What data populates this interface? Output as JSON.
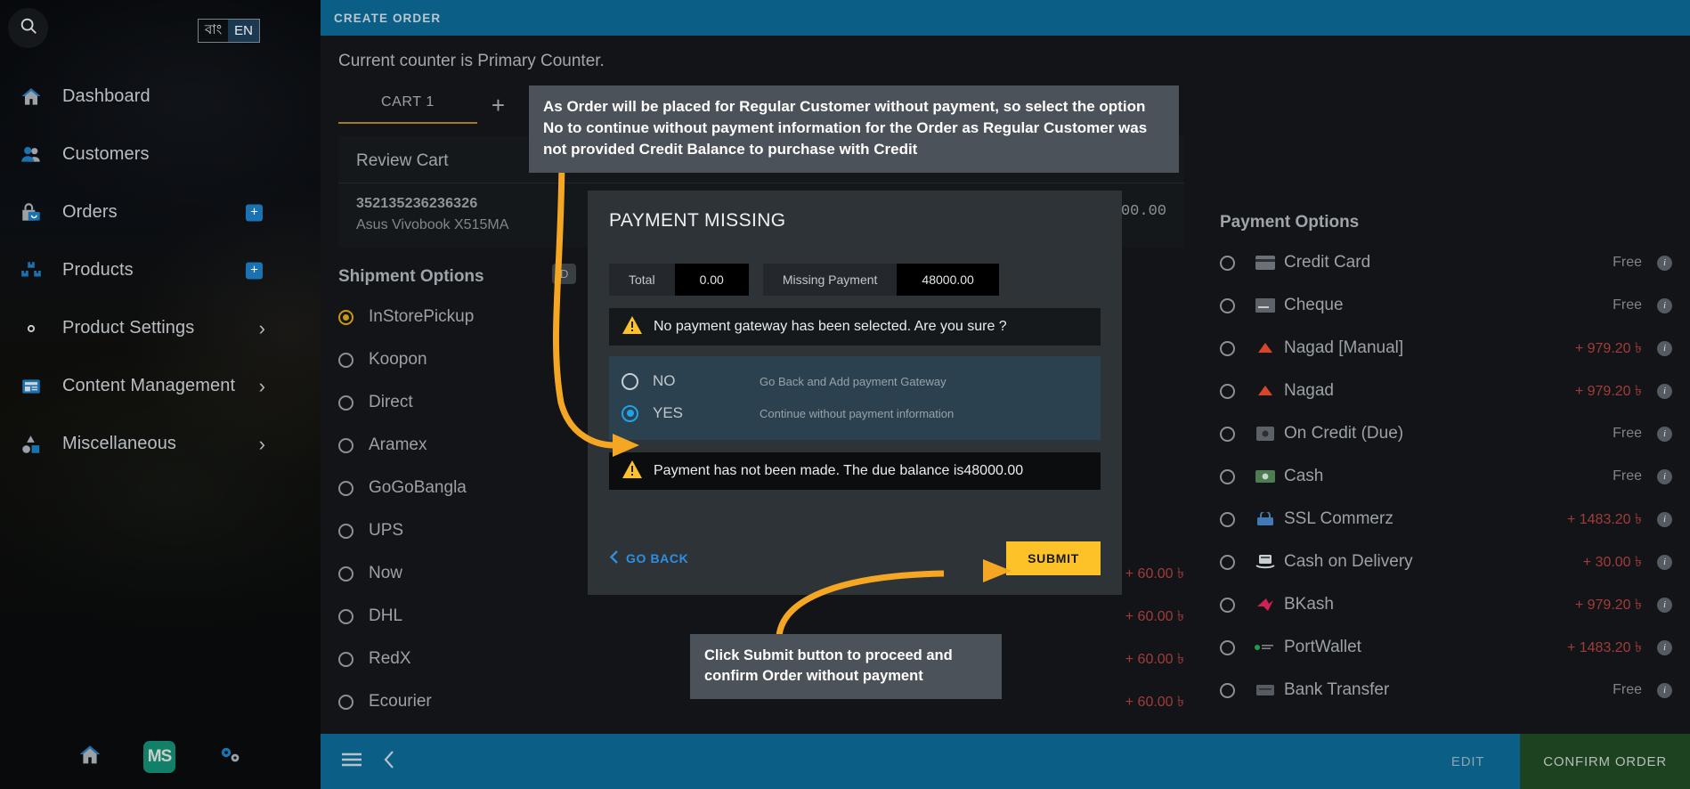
{
  "sidebar": {
    "search_icon": "search-icon",
    "language": {
      "bangla": "বাং",
      "english": "EN",
      "active": "EN"
    },
    "items": [
      {
        "label": "Dashboard",
        "icon": "home-icon",
        "badge": "",
        "chevron": false
      },
      {
        "label": "Customers",
        "icon": "users-icon",
        "badge": "",
        "chevron": false
      },
      {
        "label": "Orders",
        "icon": "bag-icon",
        "badge": "+",
        "chevron": false
      },
      {
        "label": "Products",
        "icon": "boxes-icon",
        "badge": "+",
        "chevron": false
      },
      {
        "label": "Product Settings",
        "icon": "gear-icon",
        "badge": "",
        "chevron": true
      },
      {
        "label": "Content Management",
        "icon": "article-icon",
        "badge": "",
        "chevron": true
      },
      {
        "label": "Miscellaneous",
        "icon": "shapes-icon",
        "badge": "",
        "chevron": true
      }
    ],
    "footer": {
      "home_icon": "home-icon",
      "logo_text": "MS",
      "settings_icon": "gears-icon"
    }
  },
  "topbar": {
    "title": "CREATE ORDER"
  },
  "main": {
    "counter_text": "Current counter is Primary Counter.",
    "cart_tab": "CART 1",
    "cart_add": "+",
    "review_cart": {
      "title": "Review Cart",
      "edit_icon": "pencil-icon",
      "item_sku": "352135236236326",
      "item_name": "Asus Vivobook X515MA",
      "item_price": "48000.00"
    },
    "shipment": {
      "title": "Shipment Options",
      "default_badge": "D",
      "options": [
        {
          "label": "InStorePickup",
          "price": "",
          "selected": true
        },
        {
          "label": "Koopon",
          "price": "",
          "selected": false
        },
        {
          "label": "Direct",
          "price": "",
          "selected": false
        },
        {
          "label": "Aramex",
          "price": "",
          "selected": false
        },
        {
          "label": "GoGoBangla",
          "price": "",
          "selected": false
        },
        {
          "label": "UPS",
          "price": "",
          "selected": false
        },
        {
          "label": "Now",
          "price": "+ 60.00 ৳",
          "selected": false
        },
        {
          "label": "DHL",
          "price": "+ 60.00 ৳",
          "selected": false
        },
        {
          "label": "RedX",
          "price": "+ 60.00 ৳",
          "selected": false
        },
        {
          "label": "Ecourier",
          "price": "+ 60.00 ৳",
          "selected": false
        }
      ]
    },
    "payment": {
      "title": "Payment Options",
      "options": [
        {
          "label": "Credit Card",
          "price": "Free",
          "free": true,
          "icon": "credit-card-icon"
        },
        {
          "label": "Cheque",
          "price": "Free",
          "free": true,
          "icon": "cheque-icon"
        },
        {
          "label": "Nagad [Manual]",
          "price": "+ 979.20 ৳",
          "free": false,
          "icon": "nagad-icon"
        },
        {
          "label": "Nagad",
          "price": "+ 979.20 ৳",
          "free": false,
          "icon": "nagad-icon"
        },
        {
          "label": "On Credit (Due)",
          "price": "Free",
          "free": true,
          "icon": "credit-due-icon"
        },
        {
          "label": "Cash",
          "price": "Free",
          "free": true,
          "icon": "cash-icon"
        },
        {
          "label": "SSL Commerz",
          "price": "+ 1483.20 ৳",
          "free": false,
          "icon": "sslcommerz-icon"
        },
        {
          "label": "Cash on Delivery",
          "price": "+ 30.00 ৳",
          "free": false,
          "icon": "cod-icon"
        },
        {
          "label": "BKash",
          "price": "+ 979.20 ৳",
          "free": false,
          "icon": "bkash-icon"
        },
        {
          "label": "PortWallet",
          "price": "+ 1483.20 ৳",
          "free": false,
          "icon": "portwallet-icon"
        },
        {
          "label": "Bank Transfer",
          "price": "Free",
          "free": true,
          "icon": "bank-icon"
        }
      ],
      "info_glyph": "i"
    }
  },
  "modal": {
    "title": "PAYMENT MISSING",
    "total_label": "Total",
    "total_value": "0.00",
    "missing_label": "Missing Payment",
    "missing_value": "48000.00",
    "warning_top": "No payment gateway has been selected. Are you sure ?",
    "choices": [
      {
        "label": "NO",
        "desc": "Go Back and Add payment Gateway",
        "selected": false
      },
      {
        "label": "YES",
        "desc": "Continue without payment information",
        "selected": true
      }
    ],
    "warning_bottom": "Payment has not been made. The due balance is48000.00",
    "go_back": "GO BACK",
    "submit": "SUBMIT"
  },
  "tooltips": {
    "top": "As Order will be placed for Regular Customer without payment, so select the option No to continue without payment information for the Order as Regular Customer was not provided Credit Balance to purchase with Credit",
    "bottom": "Click Submit button to proceed and confirm Order without payment"
  },
  "bottombar": {
    "menu_icon": "hamburger-icon",
    "back_icon": "chevron-left-icon",
    "edit": "EDIT",
    "confirm": "CONFIRM ORDER"
  },
  "colors": {
    "accent_blue": "#0b5f87",
    "submit_yellow": "#fcc227",
    "arrow_orange": "#f5a623",
    "confirm_green": "#1d4220",
    "price_red": "#a33b3b"
  }
}
